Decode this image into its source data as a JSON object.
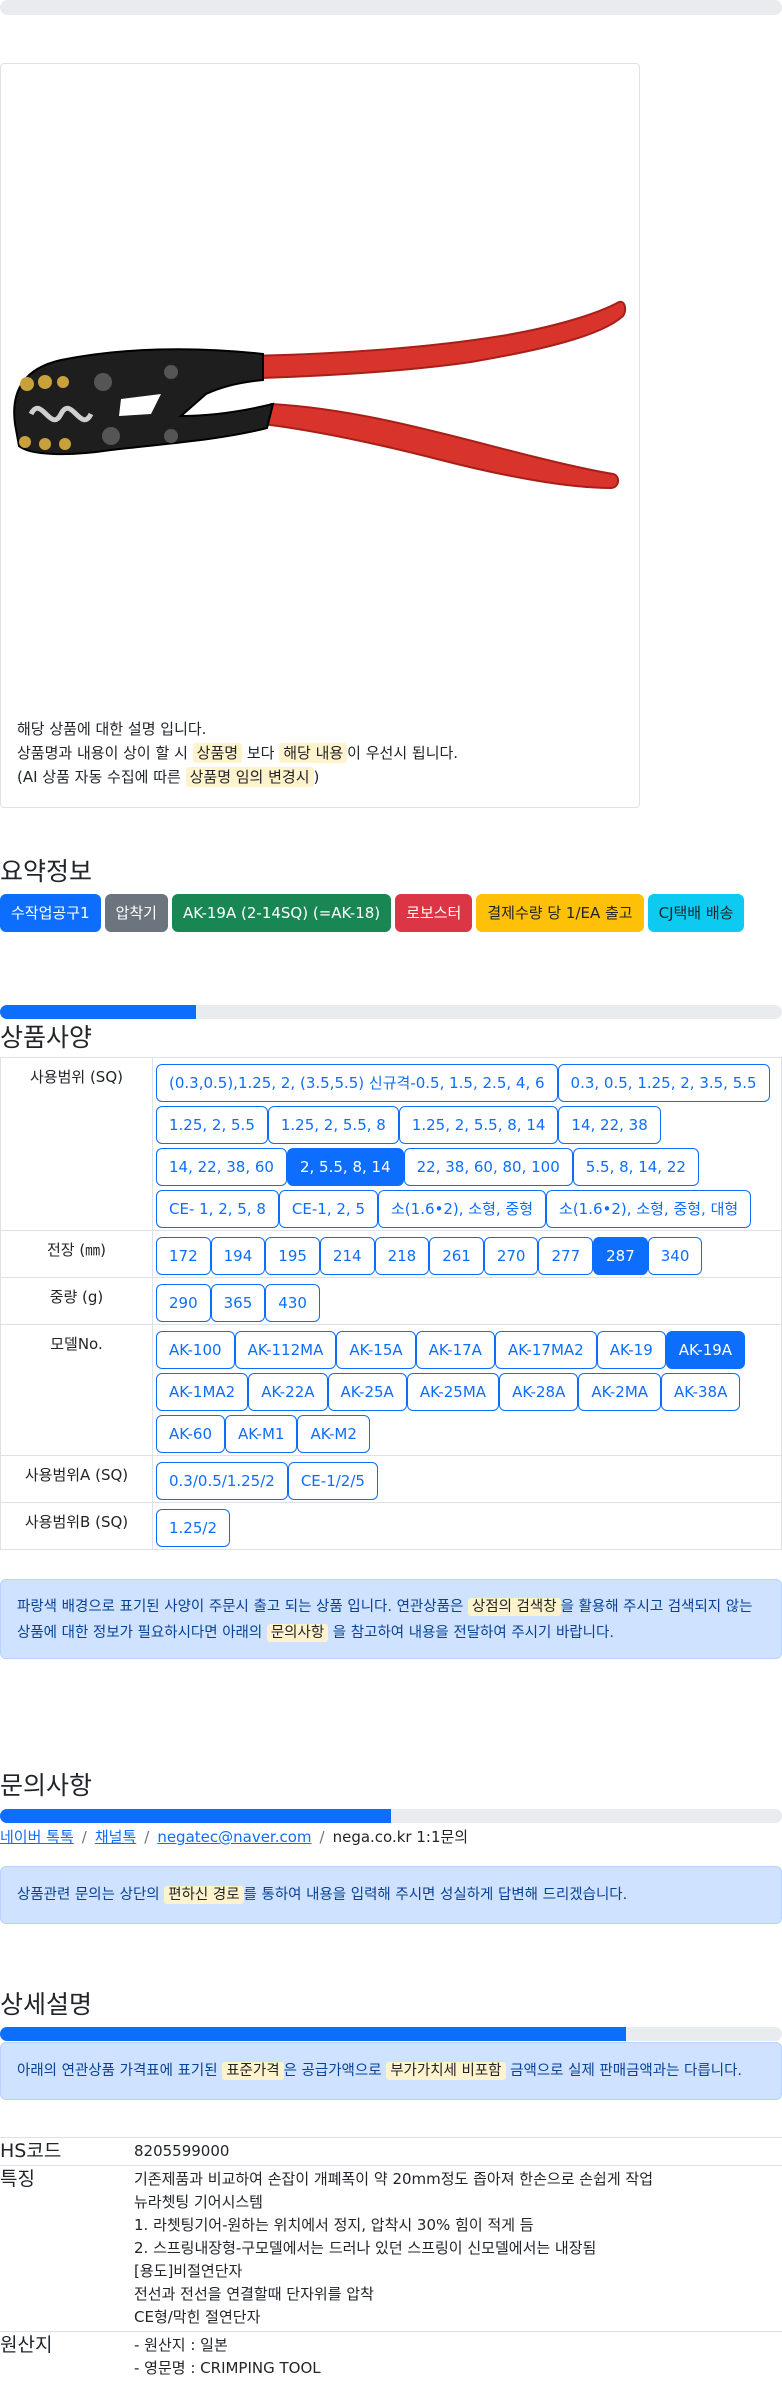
{
  "product_image": {
    "description_lines": [
      [
        {
          "t": "해당 상품에 대한 설명 입니다.",
          "h": false
        }
      ],
      [
        {
          "t": "상품명과 내용이 상이 할 시 ",
          "h": false
        },
        {
          "t": "상품명",
          "h": true
        },
        {
          "t": " 보다 ",
          "h": false
        },
        {
          "t": "해당 내용",
          "h": true
        },
        {
          "t": "이 우선시 됩니다.",
          "h": false
        }
      ],
      [
        {
          "t": "(AI 상품 자동 수집에 따른 ",
          "h": false
        },
        {
          "t": "상품명 임의 변경시",
          "h": true
        },
        {
          "t": ")",
          "h": false
        }
      ]
    ]
  },
  "summary": {
    "title": "요약정보",
    "badges": [
      {
        "label": "수작업공구1",
        "color": "#0d6efd",
        "text": "#ffffff"
      },
      {
        "label": "압착기",
        "color": "#6c757d",
        "text": "#ffffff"
      },
      {
        "label": "AK-19A (2-14SQ) (=AK-18)",
        "color": "#198754",
        "text": "#ffffff"
      },
      {
        "label": "로보스터",
        "color": "#dc3545",
        "text": "#ffffff"
      },
      {
        "label": "결제수량 당 1/EA 출고",
        "color": "#ffc107",
        "text": "#212529"
      },
      {
        "label": "CJ택배 배송",
        "color": "#0dcaf0",
        "text": "#212529"
      }
    ]
  },
  "specs": {
    "title": "상품사양",
    "progress": 0.25,
    "rows": [
      {
        "label": "사용범위 (SQ)",
        "options": [
          "(0.3,0.5),1.25, 2, (3.5,5.5) 신규격-0.5, 1.5, 2.5, 4, 6",
          "0.3, 0.5, 1.25, 2, 3.5, 5.5",
          "1.25, 2, 5.5",
          "1.25, 2, 5.5, 8",
          "1.25, 2, 5.5, 8, 14",
          "14, 22, 38",
          "14, 22, 38, 60",
          "2, 5.5, 8, 14",
          "22, 38, 60, 80, 100",
          "5.5, 8, 14, 22",
          "CE- 1, 2, 5, 8",
          "CE-1, 2, 5",
          "소(1.6•2), 소형, 중형",
          "소(1.6•2), 소형, 중형, 대형"
        ],
        "selected": "2, 5.5, 8, 14"
      },
      {
        "label": "전장 (㎜)",
        "options": [
          "172",
          "194",
          "195",
          "214",
          "218",
          "261",
          "270",
          "277",
          "287",
          "340"
        ],
        "selected": "287"
      },
      {
        "label": "중량 (g)",
        "options": [
          "290",
          "365",
          "430"
        ],
        "selected": ""
      },
      {
        "label": "모델No.",
        "options": [
          "AK-100",
          "AK-112MA",
          "AK-15A",
          "AK-17A",
          "AK-17MA2",
          "AK-19",
          "AK-19A",
          "AK-1MA2",
          "AK-22A",
          "AK-25A",
          "AK-25MA",
          "AK-28A",
          "AK-2MA",
          "AK-38A",
          "AK-60",
          "AK-M1",
          "AK-M2"
        ],
        "selected": "AK-19A"
      },
      {
        "label": "사용범위A (SQ)",
        "options": [
          "0.3/0.5/1.25/2",
          "CE-1/2/5"
        ],
        "selected": ""
      },
      {
        "label": "사용범위B (SQ)",
        "options": [
          "1.25/2"
        ],
        "selected": ""
      }
    ],
    "notice": [
      {
        "t": "파랑색 배경으로 표기된 사양이 주문시 출고 되는 상품 입니다. 연관상품은 ",
        "h": false
      },
      {
        "t": "상점의 검색창",
        "h": true
      },
      {
        "t": "을 활용해 주시고 검색되지 않는 상품에 대한 정보가 필요하시다면 아래의 ",
        "h": false
      },
      {
        "t": "문의사항",
        "h": true
      },
      {
        "t": " 을 참고하여 내용을 전달하여 주시기 바랍니다.",
        "h": false
      }
    ]
  },
  "inquiry": {
    "title": "문의사항",
    "progress": 0.5,
    "links": [
      "네이버 톡톡",
      "채널톡",
      "negatec@naver.com"
    ],
    "current": "nega.co.kr 1:1문의",
    "notice": [
      {
        "t": "상품관련 문의는 상단의 ",
        "h": false
      },
      {
        "t": "편하신 경로",
        "h": true
      },
      {
        "t": "를 통하여 내용을 입력해 주시면 성실하게 답변해 드리겠습니다.",
        "h": false
      }
    ]
  },
  "detail": {
    "title": "상세설명",
    "progress": 0.8,
    "notice": [
      {
        "t": "아래의 연관상품 가격표에 표기된 ",
        "h": false
      },
      {
        "t": "표준가격",
        "h": true
      },
      {
        "t": "은 공급가액으로 ",
        "h": false
      },
      {
        "t": "부가가치세 비포함",
        "h": true
      },
      {
        "t": " 금액으로 실제 판매금액과는 다릅니다.",
        "h": false
      }
    ],
    "rows": [
      {
        "key": "HS코드",
        "lines": [
          "8205599000"
        ]
      },
      {
        "key": "특징",
        "lines": [
          "기존제품과 비교하여 손잡이 개폐폭이 약 20mm정도 좁아져 한손으로 손쉽게 작업",
          "뉴라쳇팅 기어시스템",
          "1. 라쳇팅기어-원하는 위치에서 정지, 압착시 30% 힘이 적게 듬",
          "2. 스프링내장형-구모델에서는 드러나 있던 스프링이 신모델에서는 내장됨",
          "[용도]비절연단자",
          "전선과 전선을 연결할때 단자위를 압착",
          "CE형/막힌 절연단자"
        ]
      },
      {
        "key": "원산지",
        "lines": [
          "- 원산지 : 일본",
          "- 영문명 : CRIMPING TOOL"
        ]
      }
    ]
  }
}
